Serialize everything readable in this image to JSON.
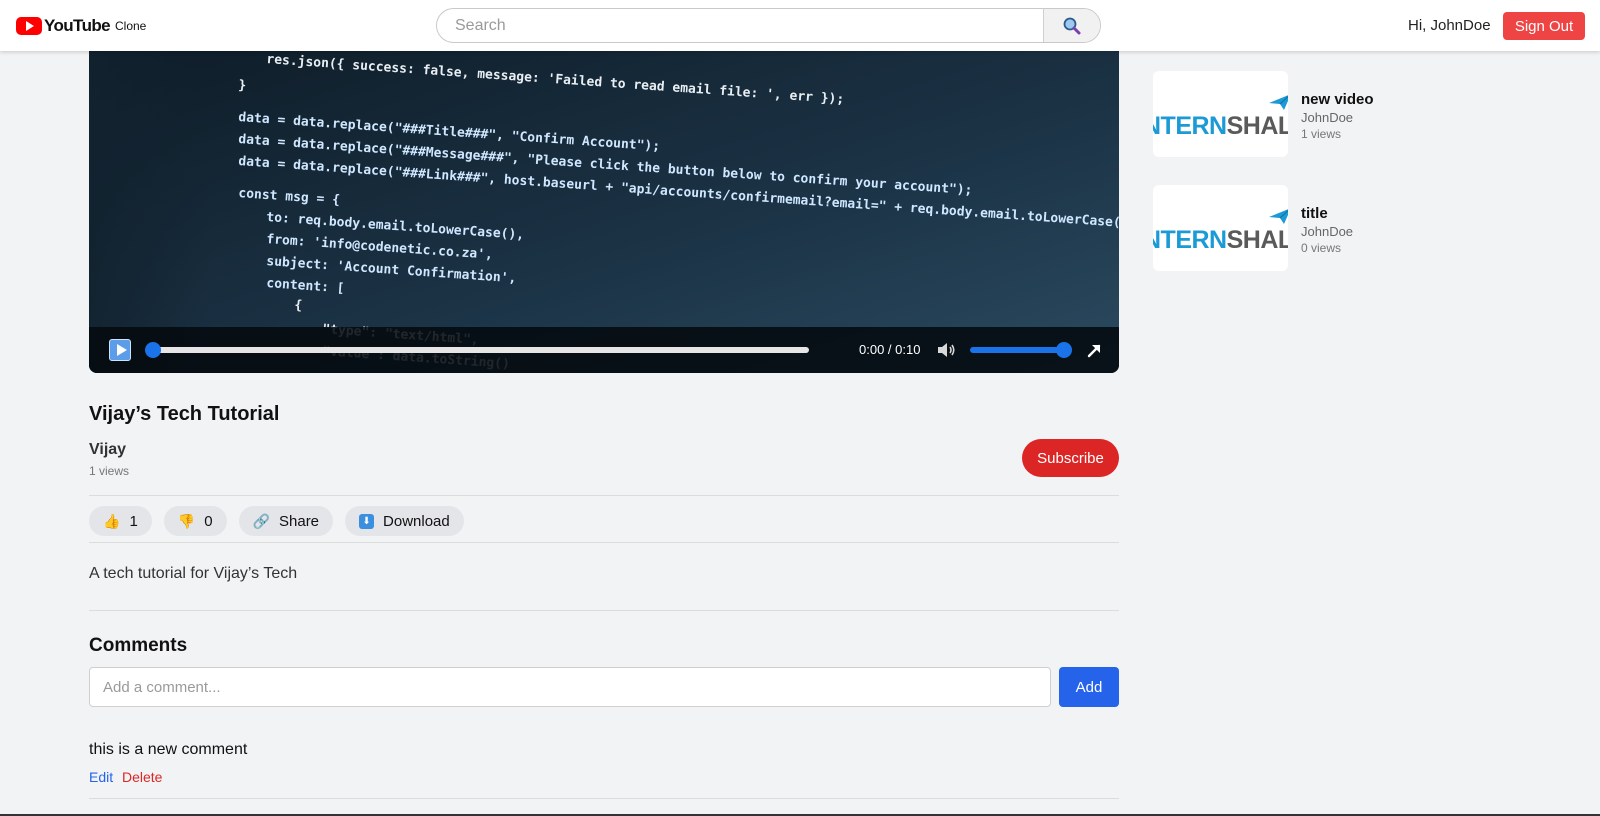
{
  "header": {
    "logo_text": "YouTube",
    "logo_sub": "Clone",
    "search_placeholder": "Search",
    "greeting": "Hi, JohnDoe",
    "signout_label": "Sign Out"
  },
  "player": {
    "time": "0:00 / 0:10",
    "progress": 0,
    "volume": 1,
    "code_lines": [
      "res.json({ success: false, message: 'Failed to read email file: ', err });",
      "}",
      "data = data.replace(\"###Title###\", \"Confirm Account\");",
      "data = data.replace(\"###Message###\", \"Please click the button below to confirm your account\");",
      "data = data.replace(\"###Link###\", host.baseurl + \"api/accounts/confirmemail?email=\" + req.body.email.toLowerCase());",
      "const msg = {",
      "to: req.body.email.toLowerCase(),",
      "from: 'info@codenetic.co.za',",
      "subject: 'Account Confirmation',",
      "content: [",
      "{",
      "\"type\": \"text/html\",",
      "\"value\": data.toString()"
    ]
  },
  "video": {
    "title": "Vijay’s Tech Tutorial",
    "channel": "Vijay",
    "views": "1 views",
    "subscribe_label": "Subscribe",
    "likes": "1",
    "dislikes": "0",
    "share_label": "Share",
    "download_label": "Download",
    "description": "A tech tutorial for Vijay’s Tech"
  },
  "comments": {
    "heading": "Comments",
    "placeholder": "Add a comment...",
    "add_label": "Add",
    "items": [
      {
        "text": "this is a new comment",
        "edit_label": "Edit",
        "delete_label": "Delete"
      }
    ]
  },
  "related": [
    {
      "thumb_text_a": "NTERN",
      "thumb_text_b": "SHAL",
      "title": "new video",
      "channel": "JohnDoe",
      "views": "1 views"
    },
    {
      "thumb_text_a": "NTERN",
      "thumb_text_b": "SHAL",
      "title": "title",
      "channel": "JohnDoe",
      "views": "0 views"
    }
  ],
  "colors": {
    "brand_red": "#ff0000",
    "signout": "#ef4444",
    "subscribe": "#dc2626",
    "primary_blue": "#2563eb",
    "internshala_blue": "#1c9ad6"
  }
}
